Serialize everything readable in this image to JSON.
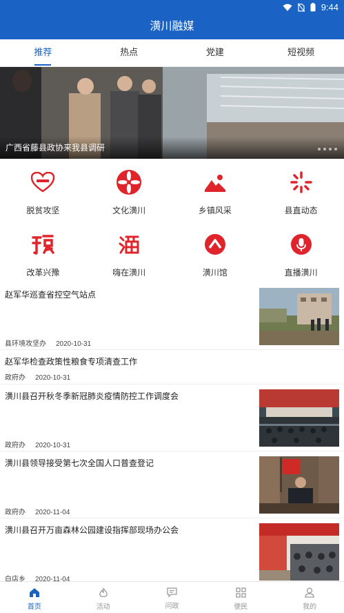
{
  "status_bar": {
    "time": "9:44"
  },
  "app": {
    "title": "潢川融媒"
  },
  "tabs": [
    {
      "label": "推荐",
      "active": true
    },
    {
      "label": "热点",
      "active": false
    },
    {
      "label": "党建",
      "active": false
    },
    {
      "label": "短视频",
      "active": false
    }
  ],
  "banner": {
    "caption": "广西省藤县政协来我县调研",
    "page_count": 4
  },
  "categories": [
    {
      "label": "脱贫攻坚",
      "icon": "heart-logo-icon"
    },
    {
      "label": "文化潢川",
      "icon": "lantern-logo-icon"
    },
    {
      "label": "乡镇风采",
      "icon": "mountain-landscape-icon"
    },
    {
      "label": "县直动态",
      "icon": "loading-spinner-icon"
    },
    {
      "label": "改革兴豫",
      "icon": "calligraphy-yu-icon"
    },
    {
      "label": "嗨在潢川",
      "icon": "calligraphy-huang-icon"
    },
    {
      "label": "潢川馆",
      "icon": "chevron-up-circle-icon"
    },
    {
      "label": "直播潢川",
      "icon": "microphone-circle-icon"
    }
  ],
  "news": [
    {
      "title": "赵军华巡查省控空气站点",
      "source": "县环境攻坚办",
      "date": "2020-10-31",
      "has_image": true
    },
    {
      "title": "赵军华检查政策性粮食专项清查工作",
      "source": "政府办",
      "date": "2020-10-31",
      "has_image": false
    },
    {
      "title": "潢川县召开秋冬季新冠肺炎疫情防控工作调度会",
      "source": "政府办",
      "date": "2020-10-31",
      "has_image": true
    },
    {
      "title": "潢川县领导接受第七次全国人口普查登记",
      "source": "政府办",
      "date": "2020-11-04",
      "has_image": true
    },
    {
      "title": "潢川县召开万亩森林公园建设指挥部现场办公会",
      "source": "白店乡",
      "date": "2020-11-04",
      "has_image": true
    }
  ],
  "bottom_nav": [
    {
      "label": "首页",
      "icon": "home-icon",
      "active": true
    },
    {
      "label": "活动",
      "icon": "flame-icon",
      "active": false
    },
    {
      "label": "问政",
      "icon": "message-icon",
      "active": false
    },
    {
      "label": "便民",
      "icon": "grid-apps-icon",
      "active": false
    },
    {
      "label": "我的",
      "icon": "user-icon",
      "active": false
    }
  ],
  "colors": {
    "primary": "#1a63c4",
    "icon_red": "#e0242c"
  }
}
